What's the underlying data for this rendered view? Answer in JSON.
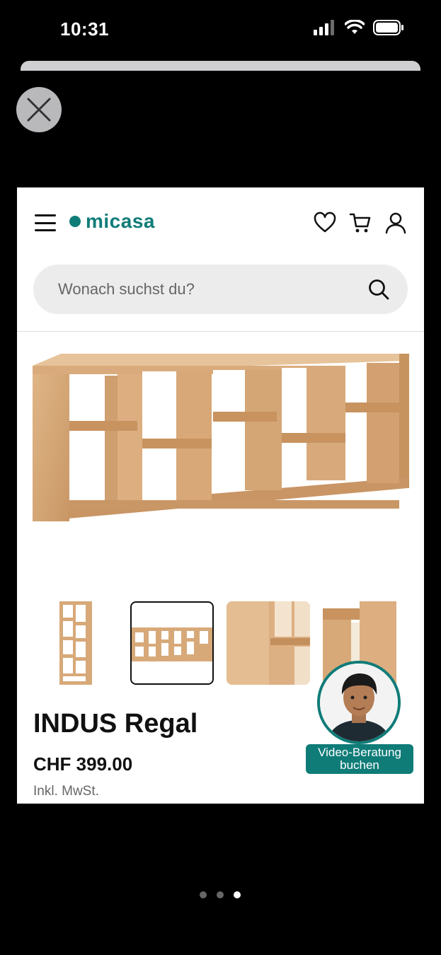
{
  "status_bar": {
    "time": "10:31"
  },
  "header": {
    "logo_text": "micasa",
    "search_placeholder": "Wonach suchst du?"
  },
  "product": {
    "title": "INDUS Regal",
    "price": "CHF 399.00",
    "tax_note": "Inkl. MwSt."
  },
  "video_consult": {
    "label_line1": "Video-Beratung",
    "label_line2": "buchen"
  },
  "pager": {
    "count": 3,
    "active_index": 2
  },
  "colors": {
    "brand": "#0f7c78",
    "wood": "#d7a979",
    "wood_dark": "#b9875a"
  },
  "icons": [
    "close-icon",
    "menu-icon",
    "heart-icon",
    "cart-icon",
    "user-icon",
    "search-icon",
    "signal-icon",
    "wifi-icon",
    "battery-icon"
  ]
}
